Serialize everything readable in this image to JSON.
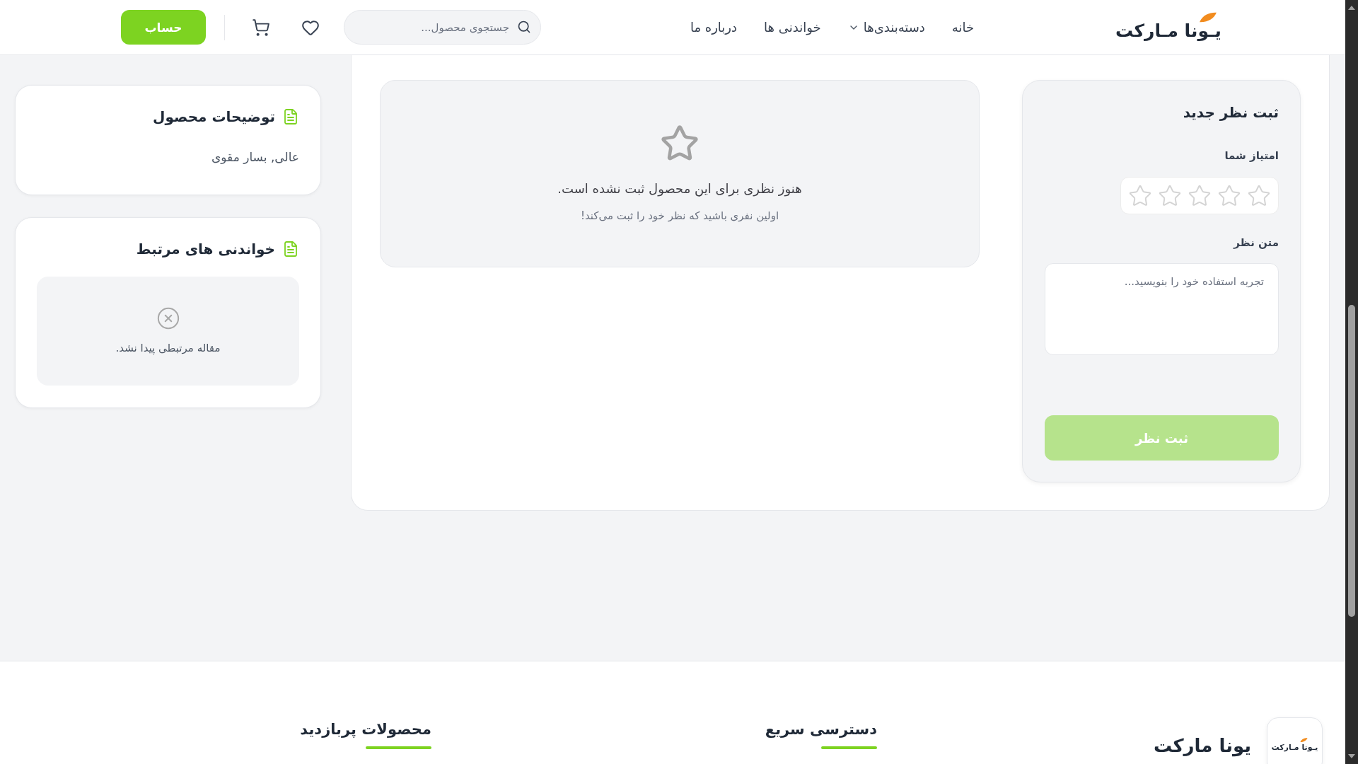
{
  "header": {
    "logo": "یـونا مـارکت",
    "nav": [
      {
        "label": "خانه",
        "has_dropdown": false
      },
      {
        "label": "دسته‌بندی‌ها",
        "has_dropdown": true
      },
      {
        "label": "خواندنی ها",
        "has_dropdown": false
      },
      {
        "label": "درباره ما",
        "has_dropdown": false
      }
    ],
    "search": {
      "placeholder": "جستجوی محصول..."
    },
    "account_button": "حساب"
  },
  "review_form": {
    "title": "ثبت نظر جدید",
    "rating_label": "امتیاز شما",
    "stars": 0,
    "comment_label": "متن نظر",
    "comment": {
      "placeholder": "تجربه استفاده خود را بنویسید..."
    },
    "submit": {
      "label": "ثبت نظر",
      "disabled": true
    }
  },
  "reviews_empty": {
    "title": "هنوز نظری برای این محصول ثبت نشده است.",
    "subtitle": "اولین نفری باشید که نظر خود را ثبت می‌کند!"
  },
  "sidebar": [
    {
      "kind": "text",
      "title": "توضیحات محصول",
      "text": "عالی, بسار مقوی"
    },
    {
      "kind": "empty",
      "title": "خواندنی های مرتبط",
      "text": "مقاله مرتبطی پیدا نشد."
    }
  ],
  "footer": {
    "logo": "یـونا مـارکت",
    "brand": "یونا مارکت",
    "columns": [
      {
        "title": "دسترسی سریع"
      },
      {
        "title": "محصولات پربازدید"
      }
    ]
  }
}
